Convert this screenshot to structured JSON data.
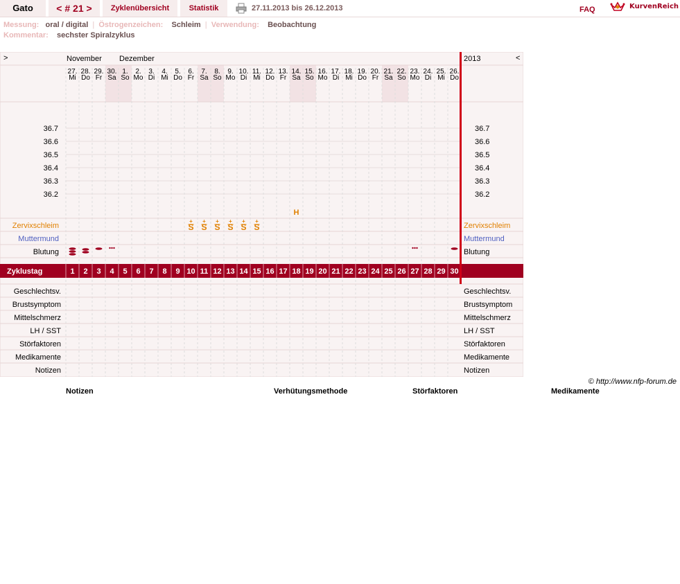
{
  "header": {
    "user_name": "Gato",
    "cycle_label": "< # 21 >",
    "overview_label": "Zyklenübersicht",
    "stats_label": "Statistik",
    "date_range": "27.11.2013 bis 26.12.2013",
    "faq_label": "FAQ",
    "logo_text": "KurvenReich"
  },
  "meta": {
    "measurement_label": "Messung:",
    "measurement_value": "oral / digital",
    "estrogen_label": "Östrogenzeichen:",
    "estrogen_value": "Schleim",
    "usage_label": "Verwendung:",
    "usage_value": "Beobachtung",
    "comment_label": "Kommentar:",
    "comment_value": "sechster Spiralzyklus"
  },
  "chart_data": {
    "type": "table",
    "nav_prev": ">",
    "nav_next": "<",
    "year": "2013",
    "month_labels": [
      "November",
      "Dezember"
    ],
    "day_numbers": [
      "27.",
      "28.",
      "29.",
      "30.",
      "1.",
      "2.",
      "3.",
      "4.",
      "5.",
      "6.",
      "7.",
      "8.",
      "9.",
      "10.",
      "11.",
      "12.",
      "13.",
      "14.",
      "15.",
      "16.",
      "17.",
      "18.",
      "19.",
      "20.",
      "21.",
      "22.",
      "23.",
      "24.",
      "25.",
      "26."
    ],
    "weekdays": [
      "Mi",
      "Do",
      "Fr",
      "Sa",
      "So",
      "Mo",
      "Di",
      "Mi",
      "Do",
      "Fr",
      "Sa",
      "So",
      "Mo",
      "Di",
      "Mi",
      "Do",
      "Fr",
      "Sa",
      "So",
      "Mo",
      "Di",
      "Mi",
      "Do",
      "Fr",
      "Sa",
      "So",
      "Mo",
      "Di",
      "Mi",
      "Do"
    ],
    "weekend_days": [
      4,
      5,
      11,
      12,
      18,
      19,
      25,
      26
    ],
    "temperature_ticks": [
      "36.7",
      "36.6",
      "36.5",
      "36.4",
      "36.3",
      "36.2"
    ],
    "temperature_values": [],
    "peak_marker": {
      "day": 18,
      "label": "H"
    },
    "rows": {
      "mucus": "Zervixschleim",
      "cervix": "Muttermund",
      "bleeding": "Blutung",
      "cycle_day": "Zyklustag",
      "sex": "Geschlechtsv.",
      "breast": "Brustsymptom",
      "midpain": "Mittelschmerz",
      "lh": "LH / SST",
      "disturbance": "Störfaktoren",
      "medication": "Medikamente",
      "notes": "Notizen"
    },
    "mucus_entries": [
      {
        "day": 10,
        "symbol": "S",
        "mark": "+"
      },
      {
        "day": 11,
        "symbol": "S",
        "mark": "+"
      },
      {
        "day": 12,
        "symbol": "S",
        "mark": "+"
      },
      {
        "day": 13,
        "symbol": "S",
        "mark": "+"
      },
      {
        "day": 14,
        "symbol": "S",
        "mark": "+"
      },
      {
        "day": 15,
        "symbol": "S",
        "mark": "+"
      }
    ],
    "bleeding_entries": [
      {
        "day": 1,
        "level": "heavy"
      },
      {
        "day": 2,
        "level": "medium"
      },
      {
        "day": 3,
        "level": "light"
      },
      {
        "day": 4,
        "level": "spotting"
      },
      {
        "day": 27,
        "level": "spotting"
      },
      {
        "day": 30,
        "level": "light"
      }
    ],
    "cycle_days": [
      "1",
      "2",
      "3",
      "4",
      "5",
      "6",
      "7",
      "8",
      "9",
      "10",
      "11",
      "12",
      "13",
      "14",
      "15",
      "16",
      "17",
      "18",
      "19",
      "20",
      "21",
      "22",
      "23",
      "24",
      "25",
      "26",
      "27",
      "28",
      "29",
      "30"
    ]
  },
  "footer": {
    "copyright": "© http://www.nfp-forum.de",
    "legend_notes": "Notizen",
    "legend_contraception": "Verhütungsmethode",
    "legend_disturbance": "Störfaktoren",
    "legend_medication": "Medikamente"
  },
  "colors": {
    "accent": "#a00020",
    "mucus": "#e08000",
    "cervix": "#5060c0",
    "weekend": "#f2e2e4",
    "panel": "#f9f3f3"
  }
}
